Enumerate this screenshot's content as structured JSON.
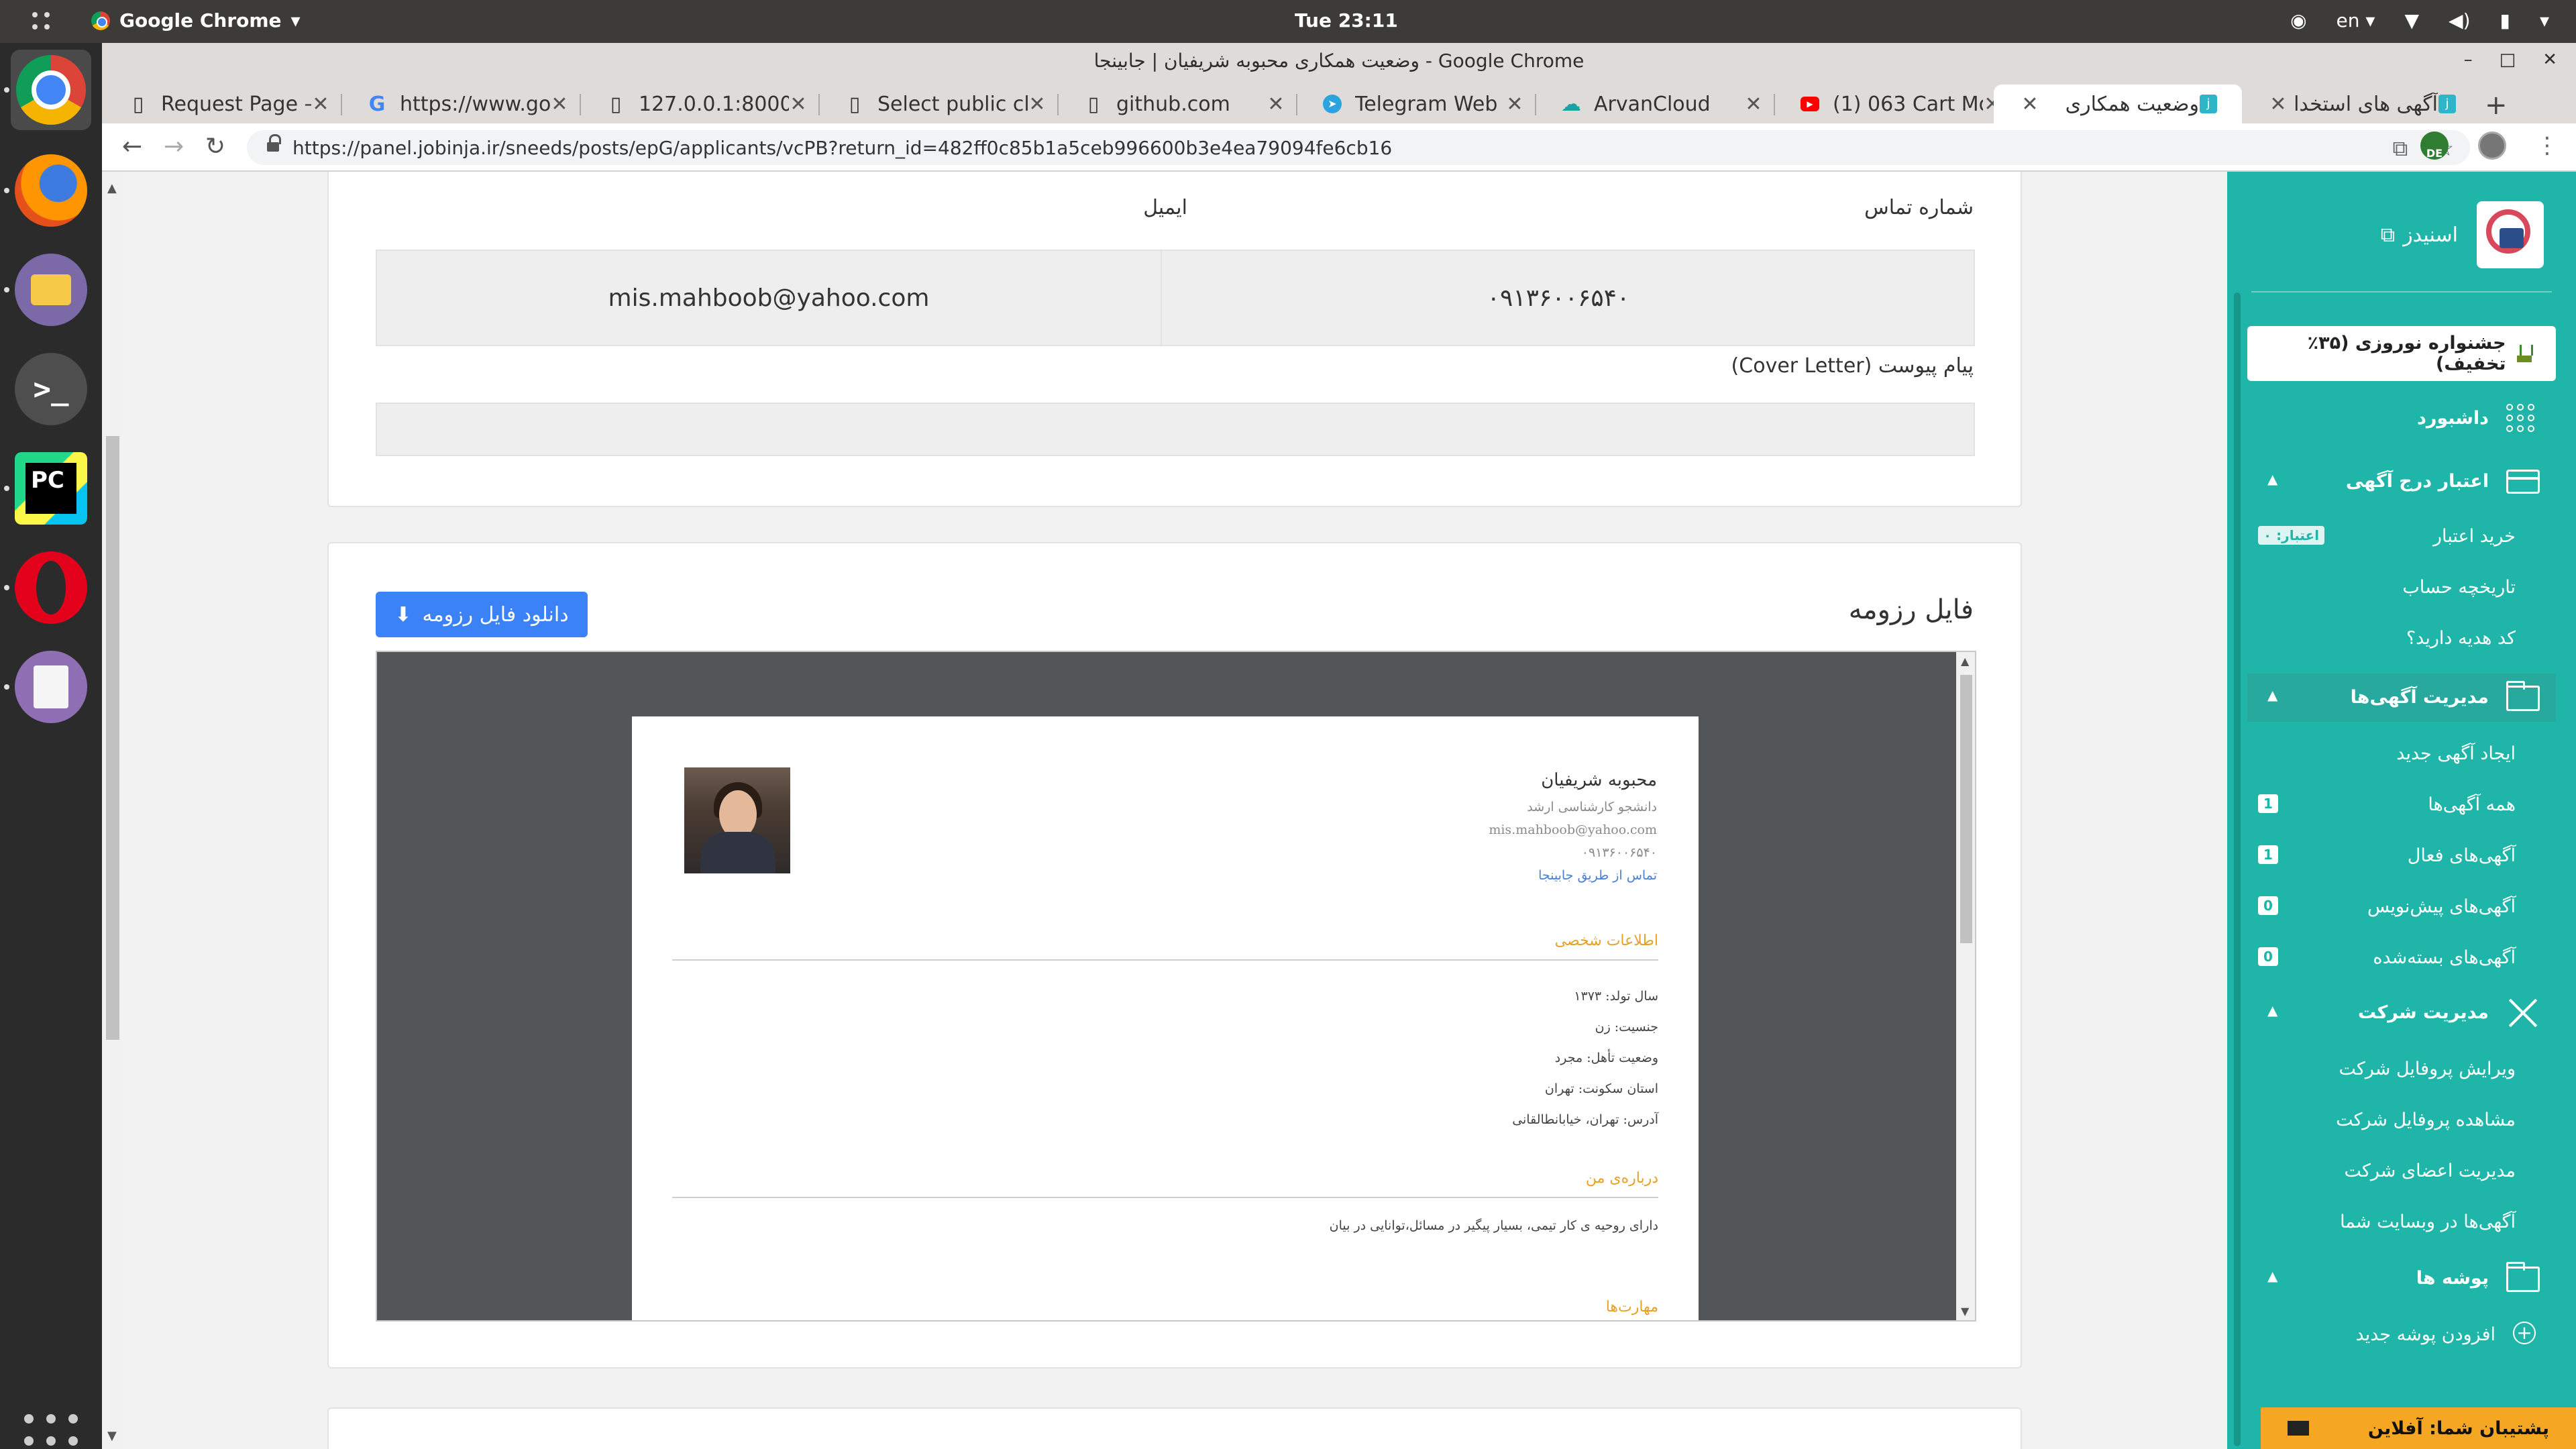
{
  "os_bar": {
    "app_name": "Google Chrome",
    "clock": "Tue 23:11",
    "language": "en"
  },
  "window": {
    "title": "وضعیت همکاری محبوبه شریفیان | جابینجا - Google Chrome"
  },
  "tabs": [
    {
      "label": "Request Page –",
      "icon": "document-icon"
    },
    {
      "label": "https://www.go",
      "icon": "google-icon"
    },
    {
      "label": "127.0.0.1:8000/",
      "icon": "document-icon"
    },
    {
      "label": "Select public cla",
      "icon": "document-icon"
    },
    {
      "label": "github.com",
      "icon": "document-icon"
    },
    {
      "label": "Telegram Web",
      "icon": "telegram-icon"
    },
    {
      "label": "ArvanCloud",
      "icon": "cloud-icon"
    },
    {
      "label": "(1) 063 Cart Mo",
      "icon": "youtube-icon"
    },
    {
      "label": "وضعیت همکاری",
      "icon": "jobinja-icon"
    },
    {
      "label": "آگهی های استخدا",
      "icon": "jobinja-icon"
    }
  ],
  "address_bar": {
    "url": "https://panel.jobinja.ir/sneeds/posts/epG/applicants/vcPB?return_id=482ff0c85b1a5ceb996600b3e4ea79094fe6cb16"
  },
  "contact_card": {
    "phone_label": "شماره تماس",
    "phone_value": "۰۹۱۳۶۰۰۶۵۴۰",
    "email_label": "ایمیل",
    "email_value": "mis.mahboob@yahoo.com",
    "cover_letter_label": "پیام پیوست (Cover Letter)",
    "cover_letter_value": ""
  },
  "resume_card": {
    "title": "فایل رزومه",
    "download_button": "دانلود فایل رزومه"
  },
  "resume_pdf": {
    "name": "محبوبه شریفیان",
    "degree": "دانشجو کارشناسی ارشد",
    "email": "mis.mahboob@yahoo.com",
    "phone": "۰۹۱۳۶۰۰۶۵۴۰",
    "contact_link": "تماس از طریق جابینجا",
    "personal_heading": "اطلاعات شخصی",
    "birth_year": "سال تولد: ۱۳۷۳",
    "gender": "جنسیت: زن",
    "marital": "وضعیت تأهل: مجرد",
    "province": "استان سکونت: تهران",
    "address": "آدرس: تهران، خیابانطالقانی",
    "about_heading": "درباره‌ی من",
    "about_text": "دارای روحیه ی کار تیمی، بسیار پیگیر در مسائل،توانایی در بیان",
    "skills_heading": "مهارت‌ها"
  },
  "sidebar": {
    "brand": "اسنیدز",
    "promo": "جشنواره نوروزی (۳۵٪ تخفیف)",
    "dashboard": "داشبورد",
    "credit_section": "اعتبار درج آگهی",
    "buy_credit": "خرید اعتبار",
    "credit_badge": "اعتبار: ۰",
    "account_history": "تاریخچه حساب",
    "gift_code": "کد هدیه دارید؟",
    "ads_section": "مدیریت آگهی‌ها",
    "new_ad": "ایجاد آگهی جدید",
    "all_ads": "همه آگهی‌ها",
    "all_ads_count": "1",
    "active_ads": "آگهی‌های فعال",
    "active_ads_count": "1",
    "draft_ads": "آگهی‌های پیش‌نویس",
    "draft_ads_count": "0",
    "closed_ads": "آگهی‌های بسته‌شده",
    "closed_ads_count": "0",
    "company_section": "مدیریت شرکت",
    "edit_profile": "ویرایش پروفایل شرکت",
    "view_profile": "مشاهده پروفایل شرکت",
    "members": "مدیریت اعضای شرکت",
    "ads_on_site": "آگهی‌ها در وبسایت شما",
    "folders_section": "پوشه ها",
    "add_folder": "افزودن پوشه جدید",
    "support": "پشتیبان شما: آفلاین"
  },
  "colors": {
    "sidebar": "#1fb5a8",
    "primary_button": "#3b82f6",
    "support_bar": "#f5a623",
    "resume_heading": "#e8a025"
  }
}
